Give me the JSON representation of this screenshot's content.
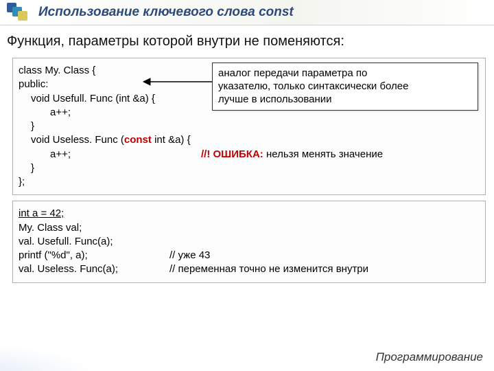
{
  "title": "Использование ключевого слова const",
  "subtitle": "Функция, параметры которой внутри не поменяются:",
  "code1": {
    "l1": "class My. Class {",
    "l2": "public:",
    "l3": "void Usefull. Func (int &a) {",
    "l4": "a++;",
    "l5": "}",
    "l6_a": "void Useless. Func (",
    "l6_const": "const",
    "l6_b": " int &a) {",
    "l7_a": "a++;",
    "l7_err": "//! ОШИБКА:",
    "l7_b": " нельзя менять значение",
    "l8": "}",
    "l9": "};"
  },
  "callout": {
    "line1": "аналог передачи параметра по",
    "line2": "указателю, только синтаксически более",
    "line3": "лучше в использовании"
  },
  "code2": {
    "l1": "int a = 42;",
    "blank1": " ",
    "l2": "My. Class val;",
    "l3": "val. Usefull. Func(a);",
    "l4a": "printf (\"%d\", a);",
    "l4b": "// уже 43",
    "blank2": " ",
    "l5a": "val. Useless. Func(a);",
    "l5b": "// переменная точно не изменится внутри"
  },
  "footer": "Программирование"
}
